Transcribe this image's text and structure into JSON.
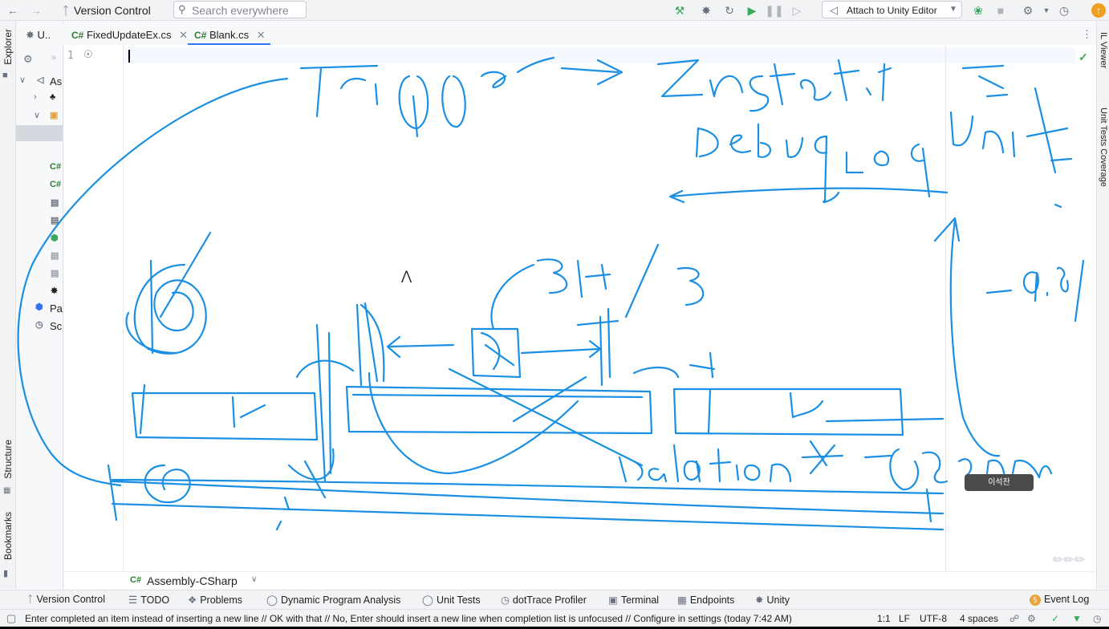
{
  "toolbar": {
    "back_icon": "arrow-left-icon",
    "forward_icon": "arrow-right-icon",
    "version_control_label": "Version Control",
    "search_placeholder": "Search everywhere",
    "attach_label": "Attach to Unity Editor"
  },
  "tabs": [
    {
      "label": "U..",
      "prefix": ""
    },
    {
      "label": "FixedUpdateEx.cs",
      "prefix": "C#"
    },
    {
      "label": "Blank.cs",
      "prefix": "C#",
      "active": true
    }
  ],
  "explorer": {
    "side_label": "Explorer",
    "rows": [
      {
        "label": "As"
      },
      {
        "label": "Pa"
      },
      {
        "label": "Sc"
      }
    ],
    "file_prefix": "C#"
  },
  "editor": {
    "line_number": "1",
    "breadcrumb": "Assembly-CSharp",
    "breadcrumb_prefix": "C#",
    "presenter_name": "이석찬"
  },
  "left_strip": {
    "structure_label": "Structure",
    "bookmarks_label": "Bookmarks"
  },
  "right_strip": {
    "il_viewer_label": "IL Viewer",
    "coverage_label": "Unit Tests Coverage"
  },
  "bottom_tools": [
    {
      "label": "Version Control",
      "icon": "branch-icon"
    },
    {
      "label": "TODO",
      "icon": "list-icon"
    },
    {
      "label": "Problems",
      "icon": "error-icon"
    },
    {
      "label": "Dynamic Program Analysis",
      "icon": "analysis-icon"
    },
    {
      "label": "Unit Tests",
      "icon": "test-icon"
    },
    {
      "label": "dotTrace Profiler",
      "icon": "profiler-icon"
    },
    {
      "label": "Terminal",
      "icon": "terminal-icon"
    },
    {
      "label": "Endpoints",
      "icon": "endpoints-icon"
    },
    {
      "label": "Unity",
      "icon": "unity-icon"
    }
  ],
  "event_log": {
    "label": "Event Log",
    "count": "5"
  },
  "status": {
    "message": "Enter completed an item instead of inserting a new line // OK with that // No, Enter should insert a new line when completion list is unfocused // Configure in settings (today 7:42 AM)",
    "position": "1:1",
    "line_sep": "LF",
    "encoding": "UTF-8",
    "indent": "4 spaces"
  },
  "colors": {
    "ink": "#1a8fe3",
    "accent": "#3574f0",
    "run_green": "#3aa75b"
  }
}
